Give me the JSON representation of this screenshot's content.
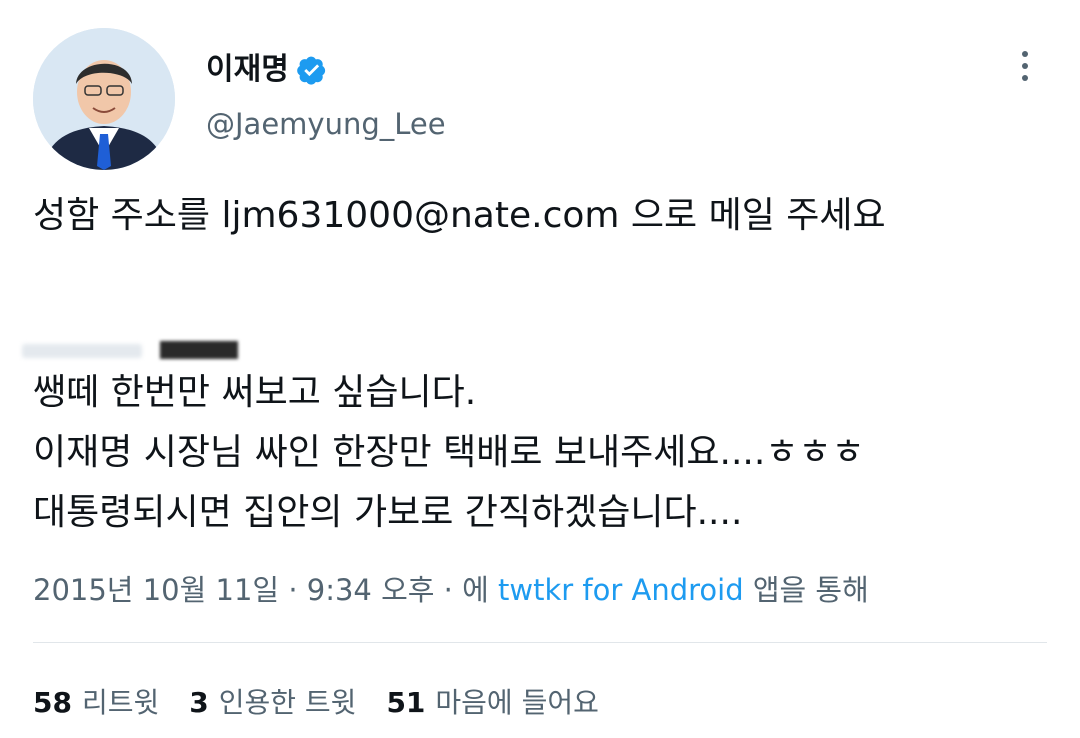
{
  "author": {
    "name": "이재명",
    "handle": "@Jaemyung_Lee",
    "verified": true
  },
  "tweet": {
    "line1": "성함 주소를 ljm631000@nate.com 으로 메일 주세요",
    "quoted_lines": [
      "쌩떼 한번만 써보고 싶습니다.",
      "이재명 시장님 싸인 한장만 택배로 보내주세요....ㅎㅎㅎ",
      "대통령되시면 집안의 가보로 간직하겠습니다...."
    ]
  },
  "meta": {
    "date": "2015년 10월 11일",
    "sep": "·",
    "time": "9:34 오후",
    "via_prefix": "에",
    "source": "twtkr for Android",
    "via_suffix": "앱을 통해"
  },
  "stats": {
    "retweets_count": "58",
    "retweets_label": "리트윗",
    "quotes_count": "3",
    "quotes_label": "인용한 트윗",
    "likes_count": "51",
    "likes_label": "마음에 들어요"
  },
  "colors": {
    "text": "#0f1419",
    "secondary": "#536471",
    "link": "#1d9bf0",
    "verified_badge": "#1d9bf0"
  }
}
